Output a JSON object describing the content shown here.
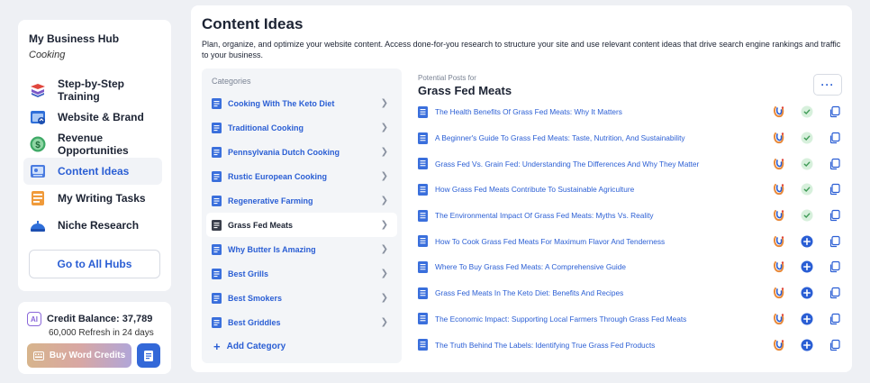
{
  "hub": {
    "title": "My Business Hub",
    "subtitle": "Cooking",
    "nav": [
      {
        "label": "Step-by-Step Training",
        "icon": "training-icon",
        "active": false
      },
      {
        "label": "Website & Brand",
        "icon": "website-icon",
        "active": false
      },
      {
        "label": "Revenue Opportunities",
        "icon": "dollar-icon",
        "active": false
      },
      {
        "label": "Content Ideas",
        "icon": "content-icon",
        "active": true
      },
      {
        "label": "My Writing Tasks",
        "icon": "tasks-icon",
        "active": false
      },
      {
        "label": "Niche Research",
        "icon": "research-icon",
        "active": false
      }
    ],
    "all_hubs_label": "Go to All Hubs"
  },
  "credits": {
    "badge": "AI",
    "title": "Credit Balance: 37,789",
    "refresh": "60,000 Refresh in 24 days",
    "buy_label": "Buy Word Credits"
  },
  "main": {
    "title": "Content Ideas",
    "description": "Plan, organize, and optimize your website content. Access done-for-you research to structure your site and use relevant content ideas that drive search engine rankings and traffic to your business.",
    "categories_heading": "Categories",
    "categories": [
      {
        "label": "Cooking With The Keto Diet",
        "active": false
      },
      {
        "label": "Traditional Cooking",
        "active": false
      },
      {
        "label": "Pennsylvania Dutch Cooking",
        "active": false
      },
      {
        "label": "Rustic European Cooking",
        "active": false
      },
      {
        "label": "Regenerative Farming",
        "active": false
      },
      {
        "label": "Grass Fed Meats",
        "active": true
      },
      {
        "label": "Why Butter Is Amazing",
        "active": false
      },
      {
        "label": "Best Grills",
        "active": false
      },
      {
        "label": "Best Smokers",
        "active": false
      },
      {
        "label": "Best Griddles",
        "active": false
      }
    ],
    "add_category_label": "Add Category",
    "posts_subheading": "Potential Posts for",
    "posts_title": "Grass Fed Meats",
    "more_label": "···",
    "posts": [
      {
        "label": "The Health Benefits Of Grass Fed Meats: Why It Matters",
        "status": "done"
      },
      {
        "label": "A Beginner's Guide To Grass Fed Meats: Taste, Nutrition, And Sustainability",
        "status": "done"
      },
      {
        "label": "Grass Fed Vs. Grain Fed: Understanding The Differences And Why They Matter",
        "status": "done"
      },
      {
        "label": "How Grass Fed Meats Contribute To Sustainable Agriculture",
        "status": "done"
      },
      {
        "label": "The Environmental Impact Of Grass Fed Meats: Myths Vs. Reality",
        "status": "done"
      },
      {
        "label": "How To Cook Grass Fed Meats For Maximum Flavor And Tenderness",
        "status": "add"
      },
      {
        "label": "Where To Buy Grass Fed Meats: A Comprehensive Guide",
        "status": "add"
      },
      {
        "label": "Grass Fed Meats In The Keto Diet: Benefits And Recipes",
        "status": "add"
      },
      {
        "label": "The Economic Impact: Supporting Local Farmers Through Grass Fed Meats",
        "status": "add"
      },
      {
        "label": "The Truth Behind The Labels: Identifying True Grass Fed Products",
        "status": "add"
      }
    ]
  },
  "colors": {
    "accent": "#2a5ed4",
    "done_bg": "#d7f0dc",
    "done_check": "#3e9a55",
    "add_bg": "#2a5ed4"
  }
}
